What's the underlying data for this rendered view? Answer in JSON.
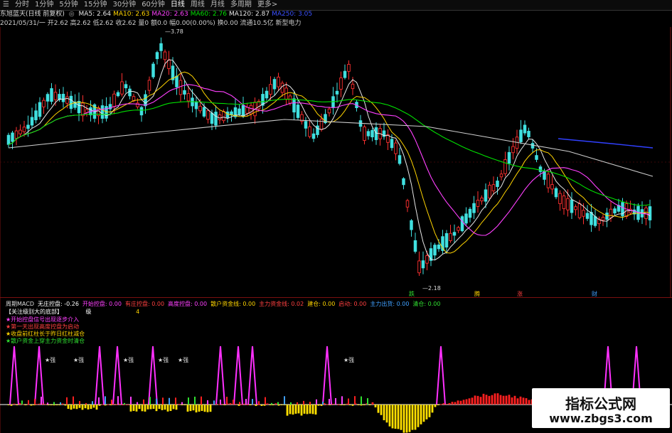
{
  "toolbar": {
    "items": [
      "分时",
      "1分钟",
      "5分钟",
      "15分钟",
      "30分钟",
      "60分钟",
      "日线",
      "周线",
      "月线",
      "多周期",
      "更多>"
    ],
    "active_index": 6
  },
  "header": {
    "stock": "东旭蓝天(日线 前复权)",
    "ma": [
      {
        "label": "MA5: 2.64",
        "color": "#e8e8e8"
      },
      {
        "label": "MA10: 2.63",
        "color": "#ffd400"
      },
      {
        "label": "MA20: 2.63",
        "color": "#ff40ff"
      },
      {
        "label": "MA60: 2.76",
        "color": "#00e000"
      },
      {
        "label": "MA120: 2.87",
        "color": "#e8e8e8"
      },
      {
        "label": "MA250: 3.05",
        "color": "#3a50ff"
      }
    ],
    "ohlc": "2021/05/31/一 开2.62 高2.62 低2.62 收2.62 量0 额0.0 幅0.00(0.00%) 换0.00 流通10.5亿 新型电力"
  },
  "annotations": {
    "high": "3.78",
    "low": "2.18",
    "markers": [
      {
        "label": "跌",
        "color": "#30e030"
      },
      {
        "label": "腾",
        "color": "#ffd400"
      },
      {
        "label": "涨",
        "color": "#ff4040"
      },
      {
        "label": "财",
        "color": "#40a0ff"
      }
    ]
  },
  "indicator": {
    "title_items": [
      {
        "label": "周期MACD",
        "color": "#dddddd"
      },
      {
        "label": "无庄控盘: -0.26",
        "color": "#ffffff"
      },
      {
        "label": "开始控盘: 0.00",
        "color": "#ff40ff"
      },
      {
        "label": "有庄控盘: 0.00",
        "color": "#ff4040"
      },
      {
        "label": "高度控盘: 0.00",
        "color": "#ff40ff"
      },
      {
        "label": "散户资金线: 0.00",
        "color": "#ffd400"
      },
      {
        "label": "主力资金线: 0.02",
        "color": "#ff4040"
      },
      {
        "label": "建仓: 0.00",
        "color": "#ffd400"
      },
      {
        "label": "启动: 0.00",
        "color": "#ff4040"
      },
      {
        "label": "主力出货: 0.00",
        "color": "#40a0ff"
      },
      {
        "label": "清仓: 0.00",
        "color": "#30e030"
      }
    ],
    "focus": "【关注级别大的底部】",
    "level_label": "级",
    "level_value": "4",
    "legend": [
      {
        "text": "★开始控盘信号出现逐步介入",
        "color": "#ff40ff"
      },
      {
        "text": "★第一天出现高度控盘为启动",
        "color": "#ff4040"
      },
      {
        "text": "★收盘前红柱长于昨日红柱减仓",
        "color": "#ffd400"
      },
      {
        "text": "★散户资金上穿主力资金时清仓",
        "color": "#30e030"
      }
    ],
    "star_label": "★强",
    "colors": {
      "bear": "#ffe000",
      "bull": "#ff2020",
      "spike": "#ff30ff",
      "zero": "#ffffff"
    }
  },
  "watermark": {
    "line1": "指标公式网",
    "line2": "www.zbgs3.com"
  },
  "colors": {
    "up": "#ff3030",
    "down": "#40e0e0",
    "ma5": "#e8e8e8",
    "ma10": "#ffd400",
    "ma20": "#ff40ff",
    "ma60": "#00e000",
    "ma120": "#cccccc",
    "ma250": "#3040ff"
  }
}
